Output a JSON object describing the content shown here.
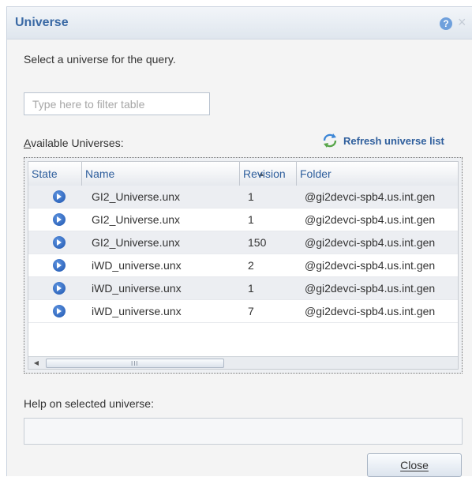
{
  "dialog": {
    "title": "Universe",
    "help_icon": "help-icon",
    "help_glyph": "?",
    "close_icon": "close-icon",
    "close_glyph": "×"
  },
  "prompt": "Select a universe for the query.",
  "filter": {
    "placeholder": "Type here to filter table",
    "value": ""
  },
  "available_label": "Available Universes:",
  "refresh": {
    "label": "Refresh universe list",
    "icon": "refresh-icon"
  },
  "table": {
    "columns": [
      "State",
      "Name",
      "Revision",
      "Folder"
    ],
    "sorted_column": "Name",
    "sort_direction": "ascending",
    "rows": [
      {
        "state": "arrow-right-circle-icon",
        "name": "GI2_Universe.unx",
        "revision": "1",
        "folder": "@gi2devci-spb4.us.int.gen"
      },
      {
        "state": "arrow-right-circle-icon",
        "name": "GI2_Universe.unx",
        "revision": "1",
        "folder": "@gi2devci-spb4.us.int.gen"
      },
      {
        "state": "arrow-right-circle-icon",
        "name": "GI2_Universe.unx",
        "revision": "150",
        "folder": "@gi2devci-spb4.us.int.gen"
      },
      {
        "state": "arrow-right-circle-icon",
        "name": "iWD_universe.unx",
        "revision": "2",
        "folder": "@gi2devci-spb4.us.int.gen"
      },
      {
        "state": "arrow-right-circle-icon",
        "name": "iWD_universe.unx",
        "revision": "1",
        "folder": "@gi2devci-spb4.us.int.gen"
      },
      {
        "state": "arrow-right-circle-icon",
        "name": "iWD_universe.unx",
        "revision": "7",
        "folder": "@gi2devci-spb4.us.int.gen"
      }
    ],
    "scroll_grip": "III"
  },
  "help_label": "Help on selected universe:",
  "help_value": "",
  "close_button": "Close",
  "colors": {
    "title": "#3b6aa5",
    "header_text": "#2f5f9d",
    "state_icon": "#2a62c0"
  }
}
